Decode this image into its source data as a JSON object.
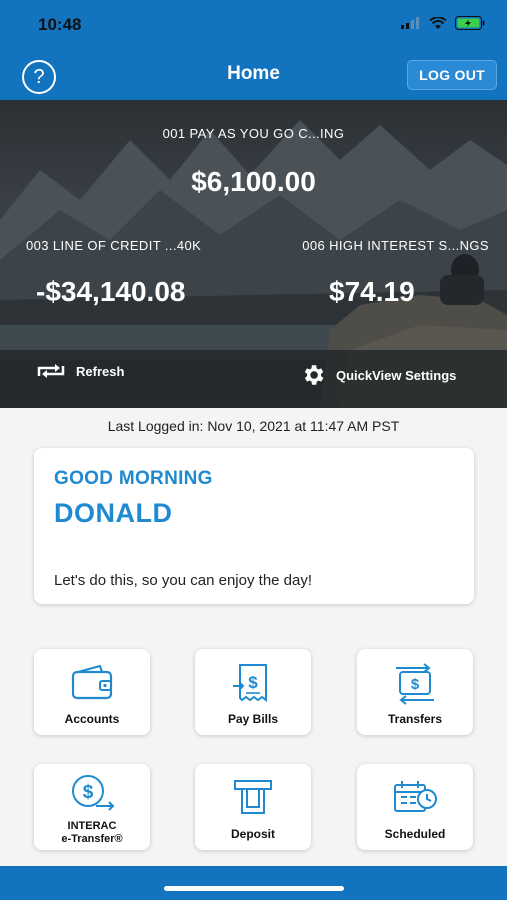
{
  "status": {
    "time": "10:48"
  },
  "nav": {
    "title": "Home",
    "help_label": "?",
    "logout_label": "LOG OUT"
  },
  "accounts": [
    {
      "name": "001 PAY AS YOU GO C...ING",
      "balance": "$6,100.00"
    },
    {
      "name": "003 LINE OF CREDIT ...40K",
      "balance": "-$34,140.08"
    },
    {
      "name": "006 HIGH INTEREST S...NGS",
      "balance": "$74.19"
    }
  ],
  "hero_actions": {
    "refresh": "Refresh",
    "settings": "QuickView Settings"
  },
  "last_logged": "Last Logged in: Nov 10, 2021 at 11:47 AM  PST",
  "greeting": {
    "line": "GOOD MORNING",
    "name": "DONALD",
    "message": "Let's do this, so you can enjoy the day!"
  },
  "tiles": {
    "accounts": "Accounts",
    "pay_bills": "Pay Bills",
    "transfers": "Transfers",
    "interac_line1": "INTERAC",
    "interac_line2": "e-Transfer®",
    "deposit": "Deposit",
    "scheduled": "Scheduled"
  },
  "colors": {
    "brand_blue": "#1273bf",
    "accent_blue": "#1f8ad0"
  }
}
